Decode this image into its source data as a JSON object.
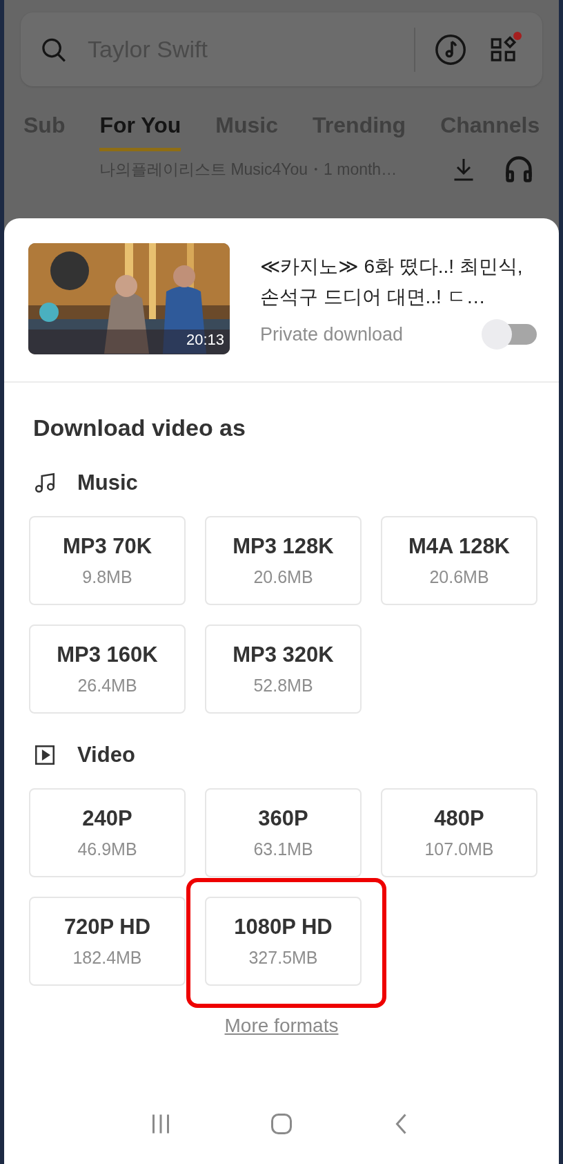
{
  "search": {
    "placeholder": "Taylor Swift",
    "apps_badge": true
  },
  "tabs": [
    {
      "label": "Sub",
      "selected": false
    },
    {
      "label": "For You",
      "selected": true
    },
    {
      "label": "Music",
      "selected": false
    },
    {
      "label": "Trending",
      "selected": false
    },
    {
      "label": "Channels",
      "selected": false
    }
  ],
  "feed_row": {
    "text": "나의플레이리스트 Music4You・1 month…"
  },
  "sheet": {
    "video": {
      "duration": "20:13",
      "title": "≪카지노≫ 6화 떴다..! 최민식, 손석구 드디어 대면..! ㄷ…",
      "private_download": {
        "label": "Private download",
        "on": false
      }
    },
    "heading": "Download video as",
    "sections": [
      {
        "kind": "music",
        "title": "Music",
        "formats": [
          {
            "name": "MP3 70K",
            "size": "9.8MB",
            "highlighted": false
          },
          {
            "name": "MP3 128K",
            "size": "20.6MB",
            "highlighted": false
          },
          {
            "name": "M4A 128K",
            "size": "20.6MB",
            "highlighted": false
          },
          {
            "name": "MP3 160K",
            "size": "26.4MB",
            "highlighted": false
          },
          {
            "name": "MP3 320K",
            "size": "52.8MB",
            "highlighted": false
          }
        ]
      },
      {
        "kind": "video",
        "title": "Video",
        "formats": [
          {
            "name": "240P",
            "size": "46.9MB",
            "highlighted": false
          },
          {
            "name": "360P",
            "size": "63.1MB",
            "highlighted": false
          },
          {
            "name": "480P",
            "size": "107.0MB",
            "highlighted": false
          },
          {
            "name": "720P HD",
            "size": "182.4MB",
            "highlighted": false
          },
          {
            "name": "1080P HD",
            "size": "327.5MB",
            "highlighted": true
          }
        ]
      }
    ],
    "more_link": "More formats"
  }
}
